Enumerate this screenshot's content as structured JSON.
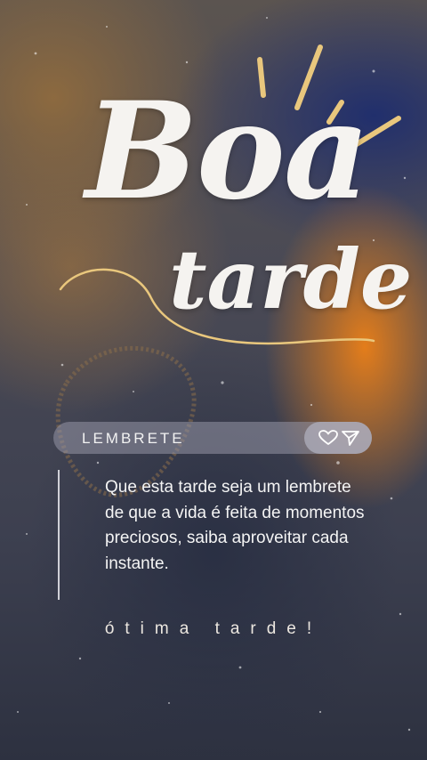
{
  "greeting": {
    "line1": "Boa",
    "line2": "tarde"
  },
  "label": {
    "text": "LEMBRETE"
  },
  "icons": {
    "like": "heart-icon",
    "share": "send-icon"
  },
  "message": {
    "text": "Que esta tarde seja um lembrete de que a vida é feita de momentos preciosos, saiba aproveitar cada instante."
  },
  "footer": {
    "text": "ótima tarde!"
  },
  "colors": {
    "accent": "#e9c77d",
    "text": "#f5f3f0",
    "orange": "#ec8018",
    "navy": "#1e2d6e"
  }
}
